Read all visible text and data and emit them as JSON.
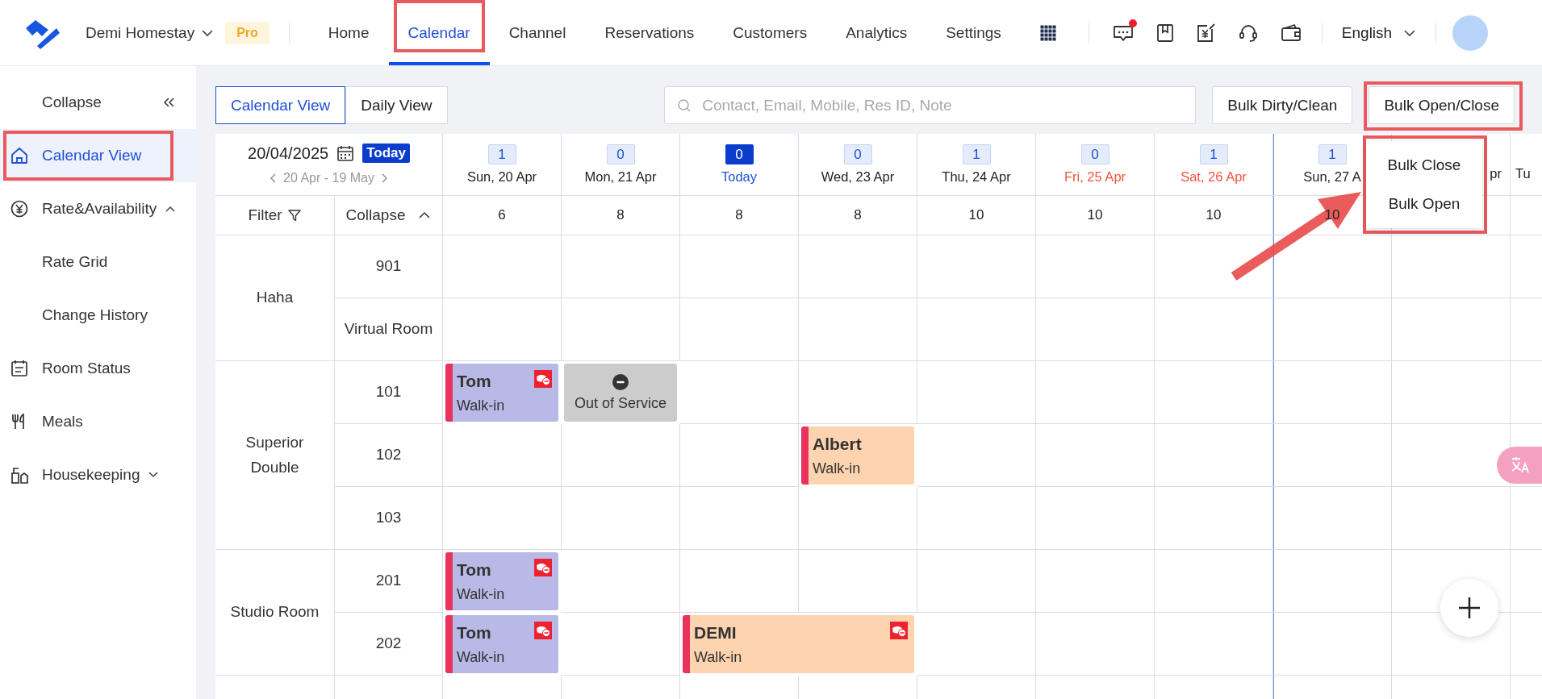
{
  "topbar": {
    "property": "Demi Homestay",
    "plan": "Pro",
    "nav": [
      {
        "label": "Home",
        "selected": false,
        "annotated": false
      },
      {
        "label": "Calendar",
        "selected": true,
        "annotated": true
      },
      {
        "label": "Channel",
        "selected": false,
        "annotated": false
      },
      {
        "label": "Reservations",
        "selected": false,
        "annotated": false
      },
      {
        "label": "Customers",
        "selected": false,
        "annotated": false
      },
      {
        "label": "Analytics",
        "selected": false,
        "annotated": false
      },
      {
        "label": "Settings",
        "selected": false,
        "annotated": false
      }
    ],
    "tools": [
      {
        "kind": "messages",
        "unread": true
      },
      {
        "kind": "bookmark",
        "unread": false
      },
      {
        "kind": "invoice",
        "unread": false
      },
      {
        "kind": "support",
        "unread": false
      },
      {
        "kind": "wallet",
        "unread": false
      }
    ],
    "language": "English"
  },
  "sidebar": {
    "collapse": "Collapse",
    "items": [
      {
        "label": "Calendar View",
        "kind": "home",
        "selected": true,
        "annotated": true
      },
      {
        "label": "Rate&Availability",
        "kind": "rates",
        "selected": false,
        "annotated": false,
        "expanded": true,
        "children": [
          {
            "label": "Rate Grid",
            "selected": false
          },
          {
            "label": "Change History",
            "selected": false
          }
        ]
      },
      {
        "label": "Room Status",
        "kind": "status",
        "selected": false,
        "annotated": false
      },
      {
        "label": "Meals",
        "kind": "meals",
        "selected": false,
        "annotated": false
      },
      {
        "label": "Housekeeping",
        "kind": "housekeeping",
        "selected": false,
        "annotated": false,
        "expanded": false
      }
    ]
  },
  "toolbar": {
    "views": [
      {
        "label": "Calendar View",
        "selected": true
      },
      {
        "label": "Daily View",
        "selected": false
      }
    ],
    "search": {
      "placeholder": "Contact, Email, Mobile, Res ID, Note"
    },
    "buttons": [
      {
        "label": "Bulk Dirty/Clean",
        "annotated": false
      },
      {
        "label": "Bulk Open/Close",
        "annotated": true
      }
    ],
    "dropdown": {
      "annotated": true,
      "items": [
        "Bulk Close",
        "Bulk Open"
      ]
    }
  },
  "calendar": {
    "date": "20/04/2025",
    "today_button": "Today",
    "range": "20 Apr - 19 May",
    "filter": "Filter",
    "collapse": "Collapse",
    "days": [
      {
        "label": "Sun, 20 Apr",
        "count": "1",
        "available": "6",
        "today": false,
        "weekend": false,
        "week_start": false
      },
      {
        "label": "Mon, 21 Apr",
        "count": "0",
        "available": "8",
        "today": false,
        "weekend": false,
        "week_start": false
      },
      {
        "label": "Today",
        "count": "0",
        "available": "8",
        "today": true,
        "weekend": false,
        "week_start": false
      },
      {
        "label": "Wed, 23 Apr",
        "count": "0",
        "available": "8",
        "today": false,
        "weekend": false,
        "week_start": false
      },
      {
        "label": "Thu, 24 Apr",
        "count": "1",
        "available": "10",
        "today": false,
        "weekend": false,
        "week_start": false
      },
      {
        "label": "Fri, 25 Apr",
        "count": "0",
        "available": "10",
        "today": false,
        "weekend": true,
        "week_start": false
      },
      {
        "label": "Sat, 26 Apr",
        "count": "1",
        "available": "10",
        "today": false,
        "weekend": true,
        "week_start": false
      },
      {
        "label": "Sun, 27 A",
        "count": "1",
        "available": "10",
        "today": false,
        "weekend": false,
        "week_start": true
      },
      {
        "label": "pr",
        "today": false,
        "weekend": false,
        "week_start": false
      },
      {
        "label": "Tu",
        "today": false,
        "weekend": false,
        "week_start": false
      }
    ],
    "groups": [
      {
        "name": "Haha",
        "rooms": [
          {
            "name": "901"
          },
          {
            "name": "Virtual Room"
          }
        ]
      },
      {
        "name": "Superior Double",
        "rooms": [
          {
            "name": "101",
            "cells": [
              {
                "kind": "guest",
                "guest": "Tom",
                "source": "Walk-in",
                "color": "#b8b9e6",
                "unpaid": true
              },
              {
                "kind": "out_of_service",
                "label": "Out of Service"
              }
            ]
          },
          {
            "name": "102",
            "cells": [
              {
                "kind": "empty"
              },
              {
                "kind": "empty"
              },
              {
                "kind": "empty"
              },
              {
                "kind": "guest",
                "guest": "Albert",
                "source": "Walk-in",
                "color": "#fdd3b0",
                "unpaid": false
              }
            ]
          },
          {
            "name": "103"
          }
        ]
      },
      {
        "name": "Studio Room",
        "rooms": [
          {
            "name": "201",
            "cells": [
              {
                "kind": "guest",
                "guest": "Tom",
                "source": "Walk-in",
                "color": "#b8b9e6",
                "unpaid": true
              }
            ]
          },
          {
            "name": "202",
            "cells": [
              {
                "kind": "guest",
                "guest": "Tom",
                "source": "Walk-in",
                "color": "#b8b9e6",
                "unpaid": true
              },
              {
                "kind": "empty"
              },
              {
                "kind": "guest",
                "guest": "DEMI",
                "source": "Walk-in",
                "color": "#fdd3b0",
                "unpaid": true
              },
              {
                "kind": "continued"
              }
            ]
          }
        ]
      }
    ]
  }
}
